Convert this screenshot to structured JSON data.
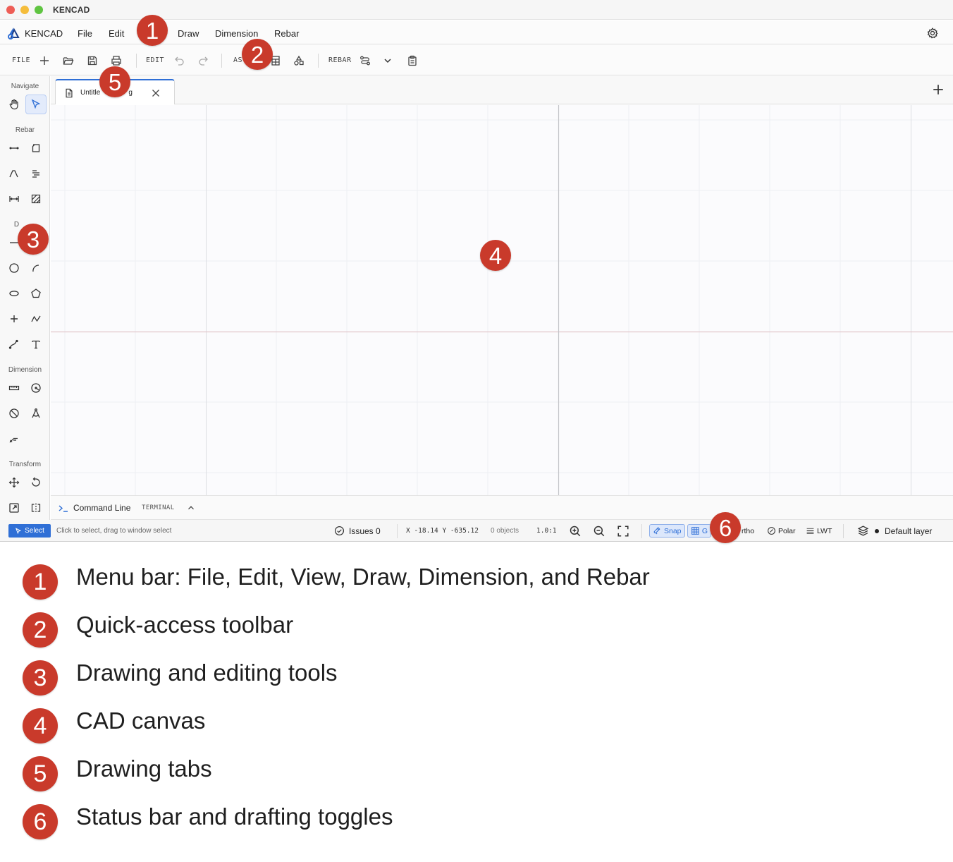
{
  "window": {
    "title": "KENCAD"
  },
  "menubar": {
    "brand": "KENCAD",
    "items": [
      "File",
      "Edit",
      "Draw",
      "Dimension",
      "Rebar"
    ]
  },
  "toolbar": {
    "groups": {
      "file": "FILE",
      "edit": "EDIT",
      "assets": "AS",
      "rebar": "REBAR"
    }
  },
  "sidebar": {
    "sections": {
      "navigate": "Navigate",
      "rebar": "Rebar",
      "draw": "D",
      "dimension": "Dimension",
      "transform": "Transform"
    }
  },
  "tabs": [
    {
      "label": "Untitle",
      "label_tail": "g"
    }
  ],
  "command_line": {
    "title": "Command Line",
    "tag": "TERMINAL"
  },
  "statusbar": {
    "mode": "Select",
    "hint": "Click to select, drag to window select",
    "issues": "Issues 0",
    "coords": "X -18.14  Y -635.12",
    "objects": "0 objects",
    "scale": "1.0:1",
    "toggles": {
      "snap": "Snap",
      "grid": "G",
      "ortho": "rtho",
      "polar": "Polar",
      "lwt": "LWT"
    },
    "layer": "Default layer"
  },
  "callouts": [
    "1",
    "2",
    "3",
    "4",
    "5",
    "6"
  ],
  "legend": [
    {
      "num": "1",
      "text": "Menu bar: File, Edit, View, Draw, Dimension, and Rebar"
    },
    {
      "num": "2",
      "text": "Quick-access toolbar"
    },
    {
      "num": "3",
      "text": "Drawing and editing tools"
    },
    {
      "num": "4",
      "text": "CAD canvas"
    },
    {
      "num": "5",
      "text": "Drawing tabs"
    },
    {
      "num": "6",
      "text": "Status bar and drafting toggles"
    }
  ],
  "colors": {
    "accent": "#2f6fd6",
    "callout": "#c93a2b",
    "axis_x": "#e2c6cc"
  }
}
